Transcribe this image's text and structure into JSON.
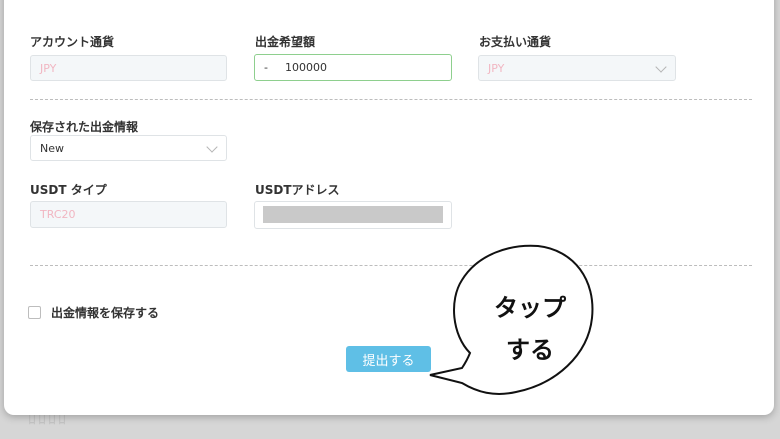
{
  "background": {
    "ghost_text": "ﾛﾛﾛﾛ"
  },
  "form": {
    "account_currency": {
      "label": "アカウント通貨",
      "value": "JPY"
    },
    "withdraw_amount": {
      "label": "出金希望額",
      "prefix": "-",
      "value": "100000"
    },
    "payment_currency": {
      "label": "お支払い通貨",
      "value": "JPY"
    },
    "saved_info": {
      "label": "保存された出金情報",
      "value": "New"
    },
    "usdt_type": {
      "label": "USDT タイプ",
      "value": "TRC20"
    },
    "usdt_address": {
      "label": "USDTアドレス"
    },
    "save_checkbox_label": "出金情報を保存する",
    "submit_label": "提出する"
  },
  "callout": {
    "line1": "タップ",
    "line2": "する"
  },
  "colors": {
    "accent": "#5fbfe6",
    "active_border": "#8ecf8e",
    "disabled_text": "#f1b6c2"
  }
}
